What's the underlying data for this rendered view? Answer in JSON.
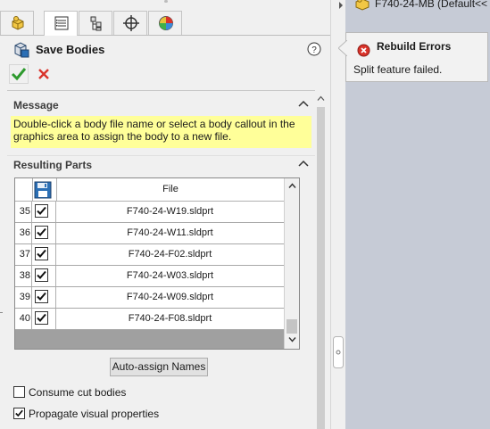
{
  "panel": {
    "tabs": [
      {
        "icon": "feature-manager-icon"
      },
      {
        "icon": "property-manager-icon",
        "active": true
      },
      {
        "icon": "configuration-manager-icon"
      },
      {
        "icon": "dimxpert-manager-icon"
      },
      {
        "icon": "display-manager-icon"
      }
    ],
    "title": "Save Bodies",
    "help_icon": "question-mark",
    "ok_icon": "green-checkmark",
    "cancel_icon": "red-x"
  },
  "message_section": {
    "label": "Message",
    "text": "Double-click a body file name or select a body callout in the graphics area to assign the body to a new file."
  },
  "parts_section": {
    "label": "Resulting Parts",
    "header_save_icon": "floppy-disk-icon",
    "columns": [
      "File"
    ],
    "rows": [
      {
        "num": "35",
        "checked": true,
        "file": "F740-24-W19.sldprt"
      },
      {
        "num": "36",
        "checked": true,
        "file": "F740-24-W11.sldprt"
      },
      {
        "num": "37",
        "checked": true,
        "file": "F740-24-F02.sldprt"
      },
      {
        "num": "38",
        "checked": true,
        "file": "F740-24-W03.sldprt"
      },
      {
        "num": "39",
        "checked": true,
        "file": "F740-24-W09.sldprt"
      },
      {
        "num": "40",
        "checked": true,
        "file": "F740-24-F08.sldprt"
      }
    ],
    "auto_assign_label": "Auto-assign Names"
  },
  "options": {
    "consume_cut_bodies": {
      "label": "Consume cut bodies",
      "checked": false
    },
    "propagate_visual": {
      "label": "Propagate visual properties",
      "checked": true
    }
  },
  "tree": {
    "root_label": "F740-24-MB  (Default<<"
  },
  "rebuild_popup": {
    "title": "Rebuild Errors",
    "message": "Split feature failed."
  },
  "colors": {
    "message_bg": "#ffff99",
    "graphics_bg": "#c6cbd6",
    "error_red": "#d9332b",
    "ok_green": "#2e9a2e"
  }
}
